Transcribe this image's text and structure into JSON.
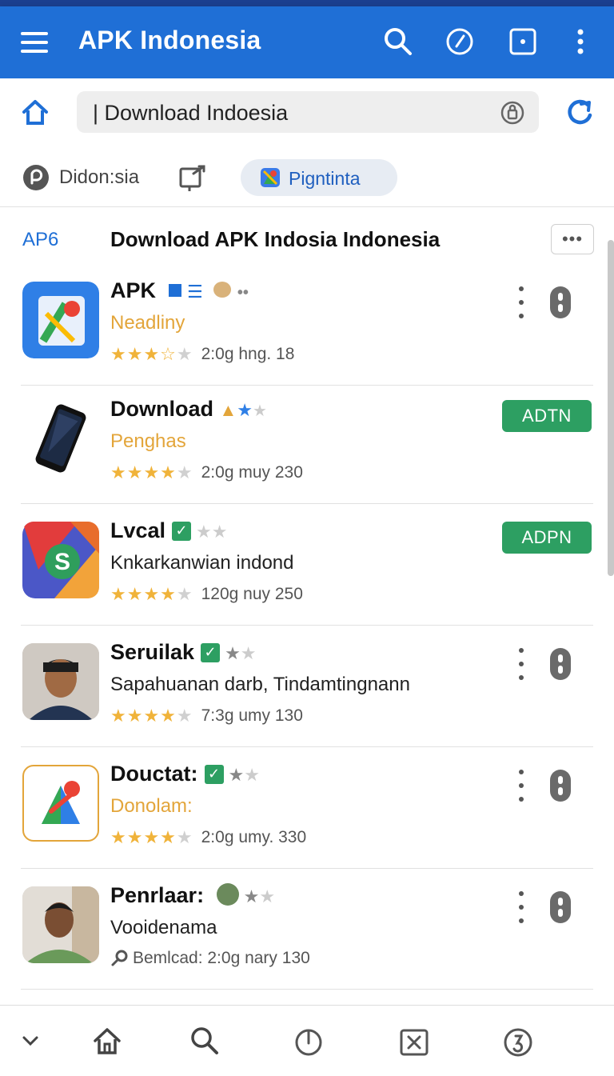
{
  "app_bar": {
    "title": "APK Indonesia"
  },
  "address_bar": {
    "value": "| Download Indoesia"
  },
  "chips": {
    "first_label": "Didon:sia",
    "selected_label": "Pigntinta"
  },
  "section": {
    "tag": "AP6",
    "title": "Download APK Indosia Indonesia",
    "more_label": "•••"
  },
  "apps": [
    {
      "name": "APK",
      "subtitle": "Neadliny",
      "subtitle_color": "#e3a53a",
      "meta": "2:0g  hng. 18",
      "rating_full": 3,
      "rating_half": 1,
      "action": "menu"
    },
    {
      "name": "Download",
      "subtitle": "Penghas",
      "subtitle_color": "#e3a53a",
      "meta": "2:0g  muy  230",
      "rating_full": 4,
      "rating_half": 0,
      "action": "button",
      "button_label": "ADTN"
    },
    {
      "name": "Lvcal",
      "subtitle": "Knkarkanwian indond",
      "subtitle_color": "#222222",
      "meta": "120g  nuy  250",
      "rating_full": 4,
      "rating_half": 0,
      "action": "button",
      "button_label": "ADPN"
    },
    {
      "name": "Seruilak",
      "subtitle": "Sapahuanan darb, Tindamtingnann",
      "subtitle_color": "#222222",
      "meta": "7:3g  umy  130",
      "rating_full": 4,
      "rating_half": 0,
      "action": "menu"
    },
    {
      "name": "Douctat:",
      "subtitle": "Donolam:",
      "subtitle_color": "#e3a53a",
      "meta": "2:0g  umy. 330",
      "rating_full": 4,
      "rating_half": 0,
      "action": "menu"
    },
    {
      "name": "Penrlaar:",
      "subtitle": "Vooidenama",
      "subtitle_color": "#222222",
      "meta": "Bemlcad: 2:0g  nary  130",
      "rating_full": 0,
      "rating_half": 0,
      "action": "menu"
    }
  ],
  "colors": {
    "primary": "#1f6fd6",
    "green": "#2d9f62",
    "star": "#f0b33a",
    "accent_subtitle": "#e3a53a"
  },
  "icons": {
    "app_bar": [
      "menu-icon",
      "search-icon",
      "compass-icon",
      "square-icon",
      "more-vert-icon"
    ],
    "bottom_nav": [
      "chevron-down-icon",
      "home-icon",
      "search-icon",
      "power-icon",
      "close-box-icon",
      "refresh-circle-icon"
    ]
  }
}
